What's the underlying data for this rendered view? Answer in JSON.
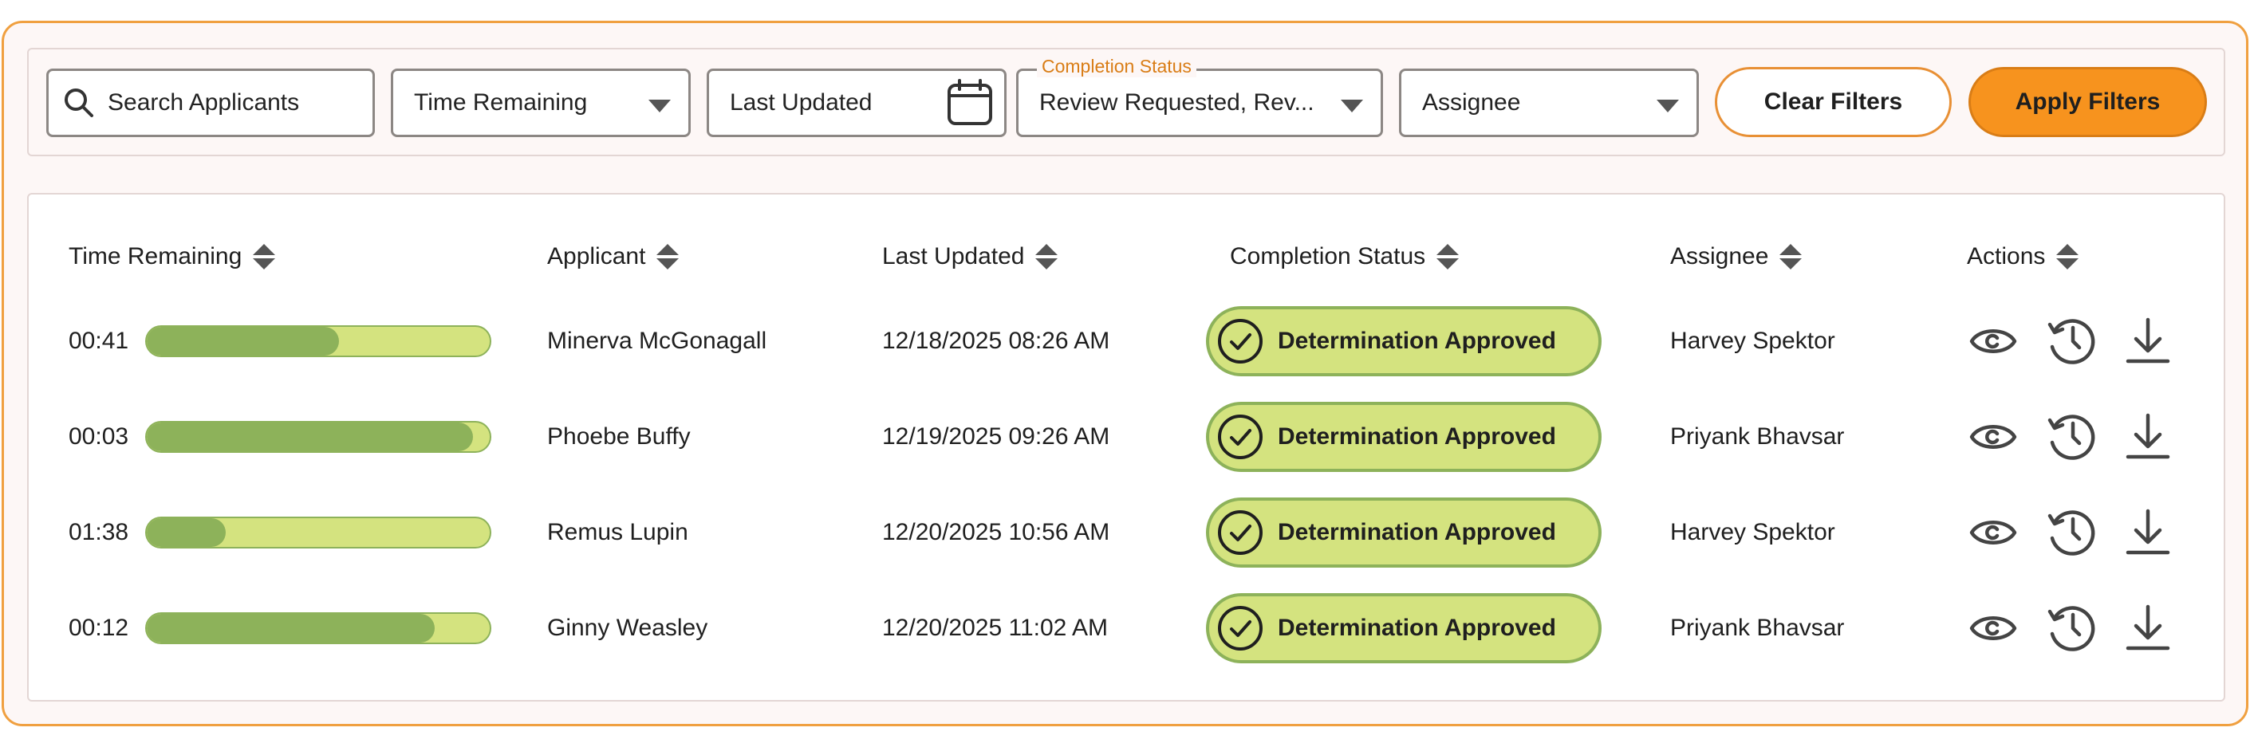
{
  "filters": {
    "search_placeholder": "Search Applicants",
    "time_remaining": "Time Remaining",
    "last_updated": "Last Updated",
    "completion_status_legend": "Completion Status",
    "completion_status_value": "Review Requested, Rev...",
    "assignee": "Assignee",
    "clear_label": "Clear Filters",
    "apply_label": "Apply Filters"
  },
  "table": {
    "headers": [
      "Time Remaining",
      "Applicant",
      "Last Updated",
      "Completion Status",
      "Assignee",
      "Actions"
    ],
    "rows": [
      {
        "time": "00:41",
        "progress": 0.56,
        "applicant": "Minerva McGonagall",
        "updated": "12/18/2025 08:26 AM",
        "status": "Determination Approved",
        "assignee": "Harvey Spektor"
      },
      {
        "time": "00:03",
        "progress": 0.95,
        "applicant": "Phoebe Buffy",
        "updated": "12/19/2025 09:26 AM",
        "status": "Determination Approved",
        "assignee": "Priyank Bhavsar"
      },
      {
        "time": "01:38",
        "progress": 0.23,
        "applicant": "Remus Lupin",
        "updated": "12/20/2025 10:56 AM",
        "status": "Determination Approved",
        "assignee": "Harvey Spektor"
      },
      {
        "time": "00:12",
        "progress": 0.84,
        "applicant": "Ginny Weasley",
        "updated": "12/20/2025 11:02 AM",
        "status": "Determination Approved",
        "assignee": "Priyank Bhavsar"
      }
    ],
    "action_icons": [
      "eye-icon",
      "history-icon",
      "download-icon"
    ]
  },
  "colors": {
    "accent_orange": "#f7931e",
    "border_orange": "#f0a040",
    "status_green_fill": "#d4e37f",
    "status_green_dark": "#8db25a"
  }
}
